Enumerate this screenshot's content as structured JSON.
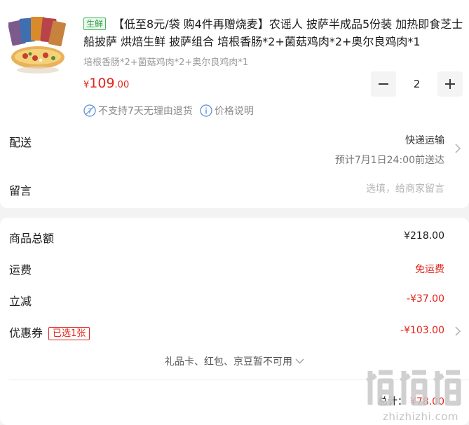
{
  "product": {
    "tag": "生鲜",
    "title": "【低至8元/袋 购4件再赠烧麦】农谣人 披萨半成品5份装 加热即食芝士船披萨 烘焙生鲜 披萨组合 培根香肠*2+菌菇鸡肉*2+奥尔良鸡肉*1",
    "variant": "培根香肠*2+菌菇鸡肉*2+奥尔良鸡肉*1",
    "price_symbol": "¥",
    "price_int": "109",
    "price_dec": ".00",
    "quantity": "2",
    "policy_no_return": "不支持7天无理由退货",
    "policy_price_info": "价格说明",
    "icons": {
      "no_return": "no-return-icon",
      "info": "info-icon",
      "minus": "minus-icon",
      "plus": "plus-icon"
    }
  },
  "delivery": {
    "label": "配送",
    "method": "快递运输",
    "eta": "预计7月1日24:00前送达"
  },
  "note": {
    "label": "留言",
    "placeholder": "选填，给商家留言"
  },
  "summary": {
    "goods_total_label": "商品总额",
    "goods_total_value": "¥218.00",
    "shipping_label": "运费",
    "shipping_value": "免运费",
    "instant_discount_label": "立减",
    "instant_discount_value": "-¥37.00",
    "coupon_label": "优惠券",
    "coupon_badge": "已选1张",
    "coupon_value": "-¥103.00",
    "unavailable_note": "礼品卡、红包、京豆暂不可用",
    "total_label": "总计：",
    "total_value": "¥78.00"
  },
  "watermark": {
    "logo_glyphs": "值值值",
    "text": "zhizhizhi.com"
  },
  "colors": {
    "price_red": "#e2231a",
    "fresh_green": "#2f9e44",
    "background": "#f3f3f3"
  }
}
